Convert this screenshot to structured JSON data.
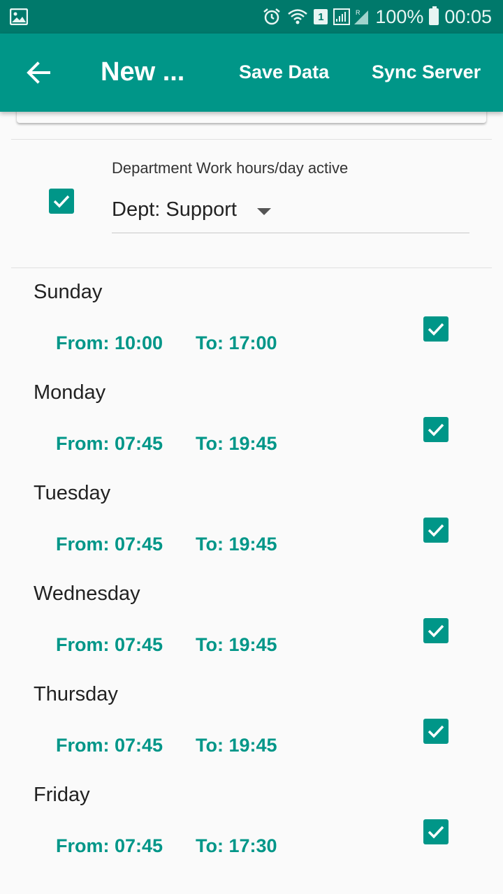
{
  "status_bar": {
    "sim_label": "1",
    "battery": "100%",
    "time": "00:05"
  },
  "app_bar": {
    "title": "New ...",
    "save_label": "Save Data",
    "sync_label": "Sync Server"
  },
  "department": {
    "label": "Department Work hours/day active",
    "checked": true,
    "selected": "Dept: Support"
  },
  "days": [
    {
      "name": "Sunday",
      "from": "From: 10:00",
      "to": "To: 17:00",
      "checked": true
    },
    {
      "name": "Monday",
      "from": "From: 07:45",
      "to": "To: 19:45",
      "checked": true
    },
    {
      "name": "Tuesday",
      "from": "From: 07:45",
      "to": "To: 19:45",
      "checked": true
    },
    {
      "name": "Wednesday",
      "from": "From: 07:45",
      "to": "To: 19:45",
      "checked": true
    },
    {
      "name": "Thursday",
      "from": "From: 07:45",
      "to": "To: 19:45",
      "checked": true
    },
    {
      "name": "Friday",
      "from": "From: 07:45",
      "to": "To: 17:30",
      "checked": true
    }
  ],
  "colors": {
    "status_bar": "#00796b",
    "app_bar": "#009688",
    "accent": "#009688"
  },
  "icons": {
    "back": "arrow-left-icon",
    "dropdown": "caret-down-icon",
    "check": "check-icon"
  }
}
